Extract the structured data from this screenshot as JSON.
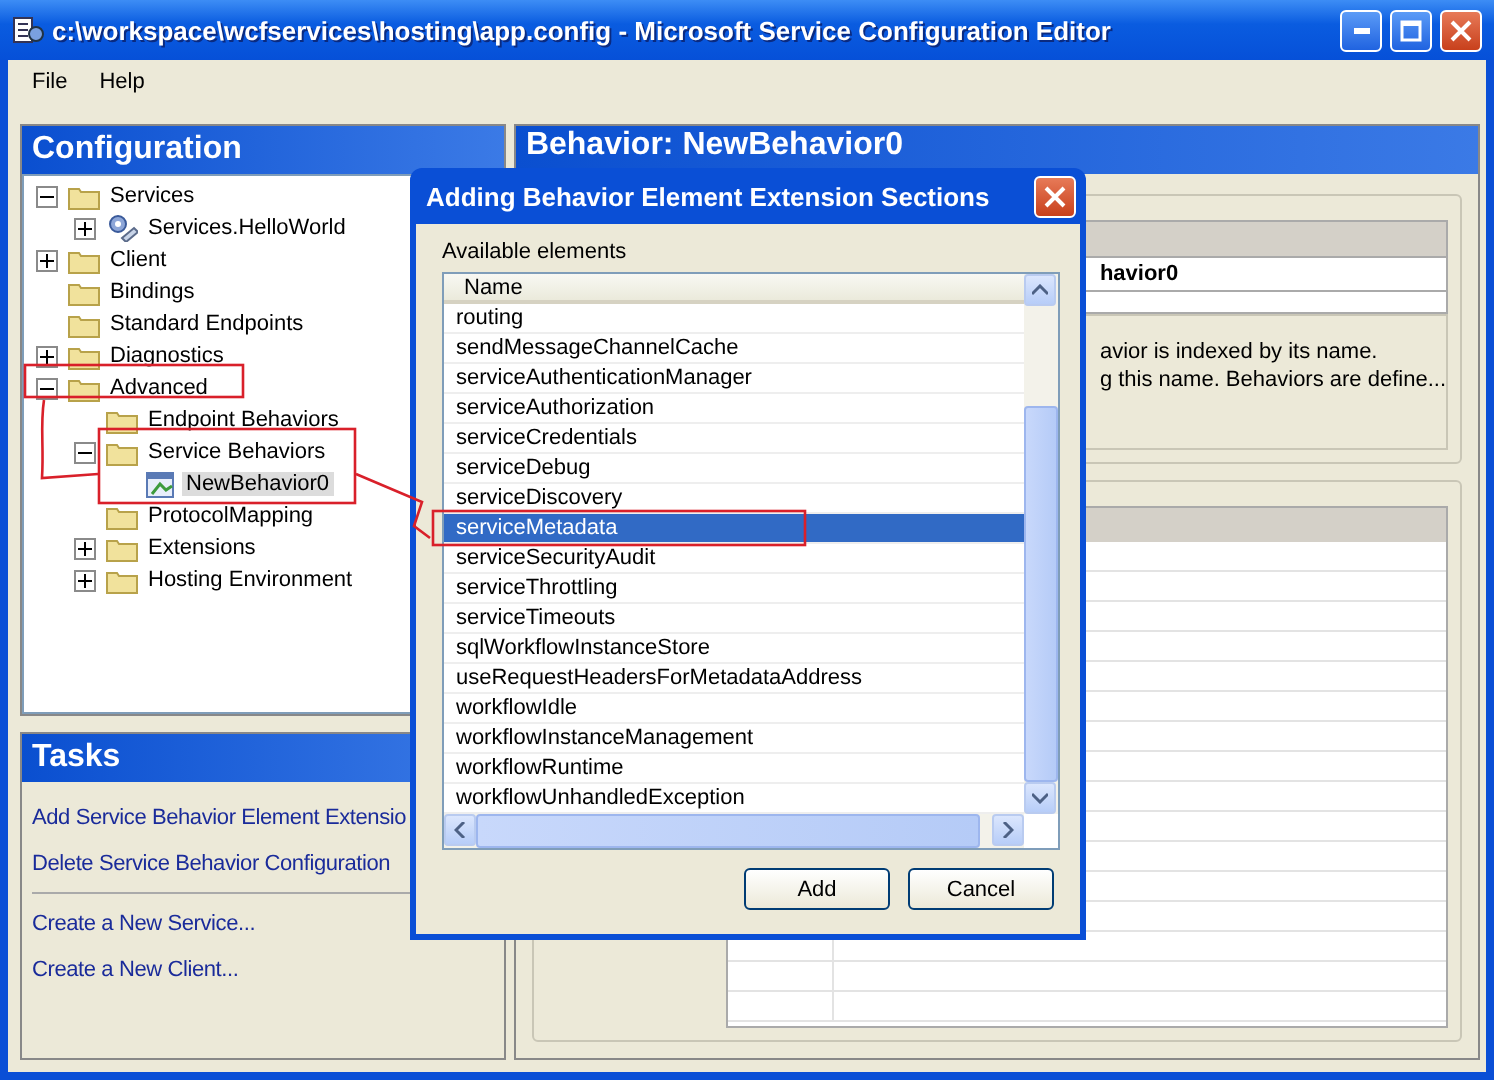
{
  "window": {
    "title": "c:\\workspace\\wcfservices\\hosting\\app.config - Microsoft Service Configuration Editor"
  },
  "menu": [
    "File",
    "Help"
  ],
  "configuration": {
    "title": "Configuration",
    "tree": [
      {
        "label": "Services",
        "kind": "folder",
        "expandable": true,
        "expanded": true,
        "selected": false,
        "children": [
          {
            "label": "Services.HelloWorld",
            "kind": "service",
            "expandable": true,
            "expanded": false,
            "selected": false
          }
        ]
      },
      {
        "label": "Client",
        "kind": "folder",
        "expandable": true,
        "expanded": false,
        "selected": false
      },
      {
        "label": "Bindings",
        "kind": "folder",
        "expandable": false,
        "selected": false
      },
      {
        "label": "Standard Endpoints",
        "kind": "folder",
        "expandable": false,
        "selected": false
      },
      {
        "label": "Diagnostics",
        "kind": "folder",
        "expandable": true,
        "expanded": false,
        "selected": false
      },
      {
        "label": "Advanced",
        "kind": "folder",
        "expandable": true,
        "expanded": true,
        "selected": false,
        "children": [
          {
            "label": "Endpoint Behaviors",
            "kind": "folder",
            "expandable": false,
            "selected": false
          },
          {
            "label": "Service Behaviors",
            "kind": "folder",
            "expandable": true,
            "expanded": true,
            "selected": false,
            "children": [
              {
                "label": "NewBehavior0",
                "kind": "behavior",
                "expandable": false,
                "selected": true
              }
            ]
          },
          {
            "label": "ProtocolMapping",
            "kind": "folder",
            "expandable": false,
            "selected": false
          },
          {
            "label": "Extensions",
            "kind": "folder",
            "expandable": true,
            "expanded": false,
            "selected": false
          },
          {
            "label": "Hosting Environment",
            "kind": "folder",
            "expandable": true,
            "expanded": false,
            "selected": false
          }
        ]
      }
    ]
  },
  "tasks": {
    "title": "Tasks",
    "groups": [
      [
        "Add Service Behavior Element Extensio",
        "Delete Service Behavior Configuration"
      ],
      [
        "Create a New Service...",
        "Create a New Client..."
      ]
    ]
  },
  "behavior": {
    "title": "Behavior: NewBehavior0",
    "name_value": "havior0",
    "description": [
      "avior is indexed by its name.",
      "g this name. Behaviors are define..."
    ]
  },
  "dialog": {
    "title": "Adding Behavior Element Extension Sections",
    "label": "Available elements",
    "column": "Name",
    "items": [
      {
        "label": "routing",
        "selected": false
      },
      {
        "label": "sendMessageChannelCache",
        "selected": false
      },
      {
        "label": "serviceAuthenticationManager",
        "selected": false
      },
      {
        "label": "serviceAuthorization",
        "selected": false
      },
      {
        "label": "serviceCredentials",
        "selected": false
      },
      {
        "label": "serviceDebug",
        "selected": false
      },
      {
        "label": "serviceDiscovery",
        "selected": false
      },
      {
        "label": "serviceMetadata",
        "selected": true
      },
      {
        "label": "serviceSecurityAudit",
        "selected": false
      },
      {
        "label": "serviceThrottling",
        "selected": false
      },
      {
        "label": "serviceTimeouts",
        "selected": false
      },
      {
        "label": "sqlWorkflowInstanceStore",
        "selected": false
      },
      {
        "label": "useRequestHeadersForMetadataAddress",
        "selected": false
      },
      {
        "label": "workflowIdle",
        "selected": false
      },
      {
        "label": "workflowInstanceManagement",
        "selected": false
      },
      {
        "label": "workflowRuntime",
        "selected": false
      },
      {
        "label": "workflowUnhandledException",
        "selected": false
      }
    ],
    "buttons": [
      "Add",
      "Cancel"
    ]
  }
}
